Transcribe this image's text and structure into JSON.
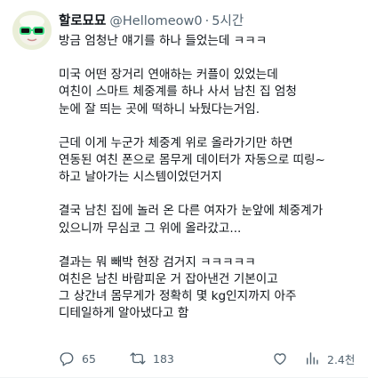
{
  "author": {
    "name": "할로묘묘",
    "handle": "@Hellomeow0",
    "separator": "·",
    "time": "5시간"
  },
  "paragraphs": [
    [
      "방금 엄청난 얘기를 하나 들었는데 ㅋㅋㅋ"
    ],
    [
      "미국 어떤 장거리 연애하는 커플이 있었는데",
      "여친이 스마트 체중계를 하나 사서 남친 집 엄청",
      "눈에 잘 띄는 곳에 떡하니 놔뒀다는거임."
    ],
    [
      "근데 이게 누군가 체중계 위로 올라가기만 하면",
      "연동된 여친 폰으로 몸무게 데이터가 자동으로 띠링~",
      "하고 날아가는 시스템이었던거지"
    ],
    [
      "결국 남친 집에 놀러 온 다른 여자가 눈앞에 체중계가",
      "있으니까 무심코 그 위에 올라갔고..."
    ],
    [
      "결과는 뭐 빼박 현장 검거지 ㅋㅋㅋㅋㅋ",
      "여친은 남친 바람피운 거 잡아낸건 기본이고",
      "그 상간녀 몸무게가 정확히 몇 kg인지까지 아주",
      "디테일하게 알아냈다고 함"
    ]
  ],
  "actions": {
    "reply_count": "65",
    "retweet_count": "183",
    "like_count": "",
    "views_count": "2.4천",
    "icons": [
      "reply-icon",
      "retweet-icon",
      "like-icon",
      "views-icon"
    ]
  },
  "colors": {
    "text": "#0f1419",
    "secondary": "#536471"
  }
}
